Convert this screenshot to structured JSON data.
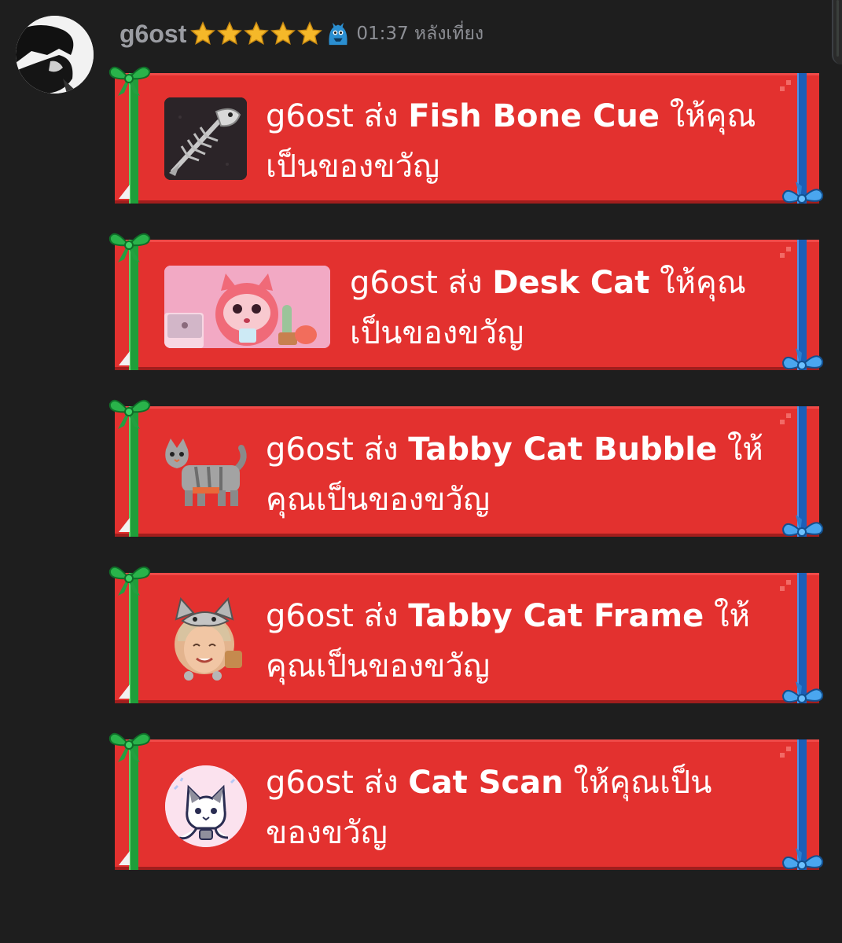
{
  "message": {
    "username": "g6ost",
    "star_count": 5,
    "badge_icon": "blue-monster-badge-icon",
    "timestamp": "01:37 หลังเที่ยง"
  },
  "colors": {
    "background": "#1e1e1e",
    "gift_red": "#e3312f",
    "ribbon_green": "#1f9e3a",
    "ribbon_blue": "#1b5fb8",
    "username": "#9a9ca2",
    "star": "#f5b829"
  },
  "gifts": [
    {
      "sender": "g6ost",
      "verb": "ส่ง",
      "item": "Fish Bone Cue",
      "line1_tail": "ให้คุณ",
      "line2": "เป็นของขวัญ",
      "thumb_icon": "fish-bone-cue-icon"
    },
    {
      "sender": "g6ost",
      "verb": "ส่ง",
      "item": "Desk Cat",
      "line1_tail": "ให้คุณ",
      "line2": "เป็นของขวัญ",
      "thumb_icon": "desk-cat-icon"
    },
    {
      "sender": "g6ost",
      "verb": "ส่ง",
      "item": "Tabby Cat Bubble",
      "line1_tail": "ให้",
      "line2": "คุณเป็นของขวัญ",
      "thumb_icon": "tabby-cat-icon"
    },
    {
      "sender": "g6ost",
      "verb": "ส่ง",
      "item": "Tabby Cat Frame",
      "line1_tail": "ให้",
      "line2": "คุณเป็นของขวัญ",
      "thumb_icon": "tabby-cat-frame-icon"
    },
    {
      "sender": "g6ost",
      "verb": "ส่ง",
      "item": "Cat Scan",
      "line1_tail": "ให้คุณเป็น",
      "line2": "ของขวัญ",
      "thumb_icon": "cat-scan-icon"
    }
  ]
}
